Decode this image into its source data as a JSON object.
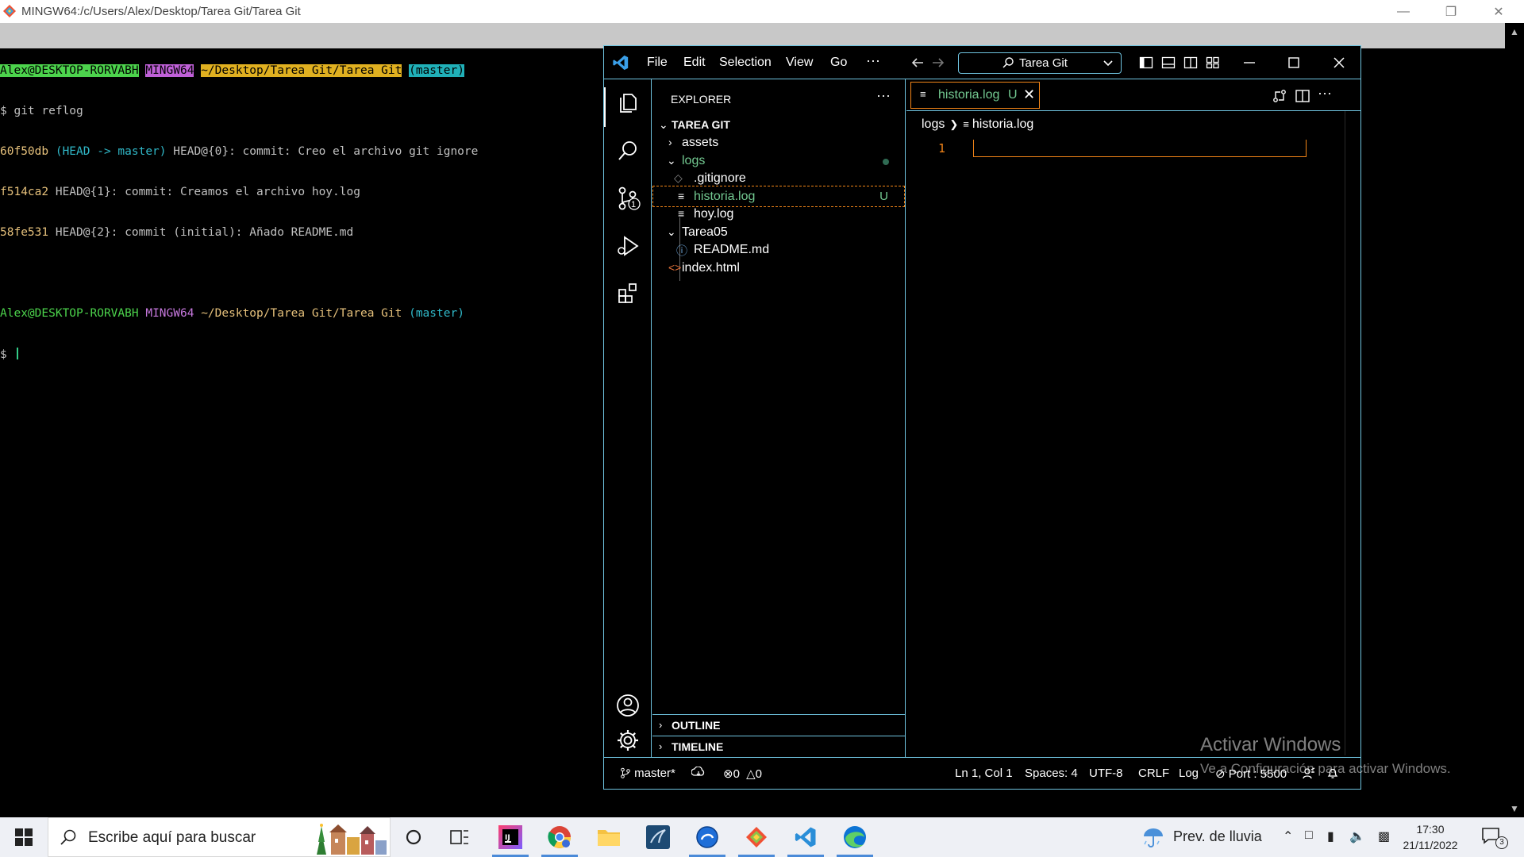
{
  "mintty": {
    "title": "MINGW64:/c/Users/Alex/Desktop/Tarea Git/Tarea Git",
    "prompt": {
      "user_host": "Alex@DESKTOP-RORVABH",
      "env": "MINGW64",
      "path": "~/Desktop/Tarea Git/Tarea Git",
      "branch": "(master)"
    },
    "command": "$ git reflog",
    "reflog": [
      {
        "hash": "60f50db",
        "ref": "(HEAD -> master)",
        "text": " HEAD@{0}: commit: Creo el archivo git ignore"
      },
      {
        "hash": "f514ca2",
        "ref": "",
        "text": " HEAD@{1}: commit: Creamos el archivo hoy.log"
      },
      {
        "hash": "58fe531",
        "ref": "",
        "text": " HEAD@{2}: commit (initial): Añado README.md"
      }
    ],
    "prompt_symbol": "$ "
  },
  "vscode": {
    "menu": [
      "File",
      "Edit",
      "Selection",
      "View",
      "Go",
      "···"
    ],
    "search_text": "Tarea Git",
    "explorer_title": "EXPLORER",
    "explorer_more": "···",
    "workspace": "TAREA GIT",
    "tree": {
      "assets": "assets",
      "logs": "logs",
      "gitignore": ".gitignore",
      "historia": "historia.log",
      "historia_badge": "U",
      "hoy": "hoy.log",
      "tarea05": "Tarea05",
      "readme": "README.md",
      "index": "index.html"
    },
    "outline": "OUTLINE",
    "timeline": "TIMELINE",
    "source_control_badge": "1",
    "tab": {
      "name": "historia.log",
      "status": "U"
    },
    "breadcrumb": {
      "folder": "logs",
      "file": "historia.log"
    },
    "line_number": "1",
    "editor_more": "···",
    "status": {
      "branch": "master*",
      "errors": "0",
      "warnings": "0",
      "position": "Ln 1, Col 1",
      "spaces": "Spaces: 4",
      "encoding": "UTF-8",
      "eol": "CRLF",
      "language": "Log",
      "port": "Port : 5500"
    }
  },
  "watermark": {
    "line1": "Activar Windows",
    "line2": "Ve a Configuración para activar Windows."
  },
  "taskbar": {
    "search_placeholder": "Escribe aquí para buscar",
    "weather": "Prev. de lluvia",
    "time": "17:30",
    "date": "21/11/2022",
    "notifications": "3"
  }
}
